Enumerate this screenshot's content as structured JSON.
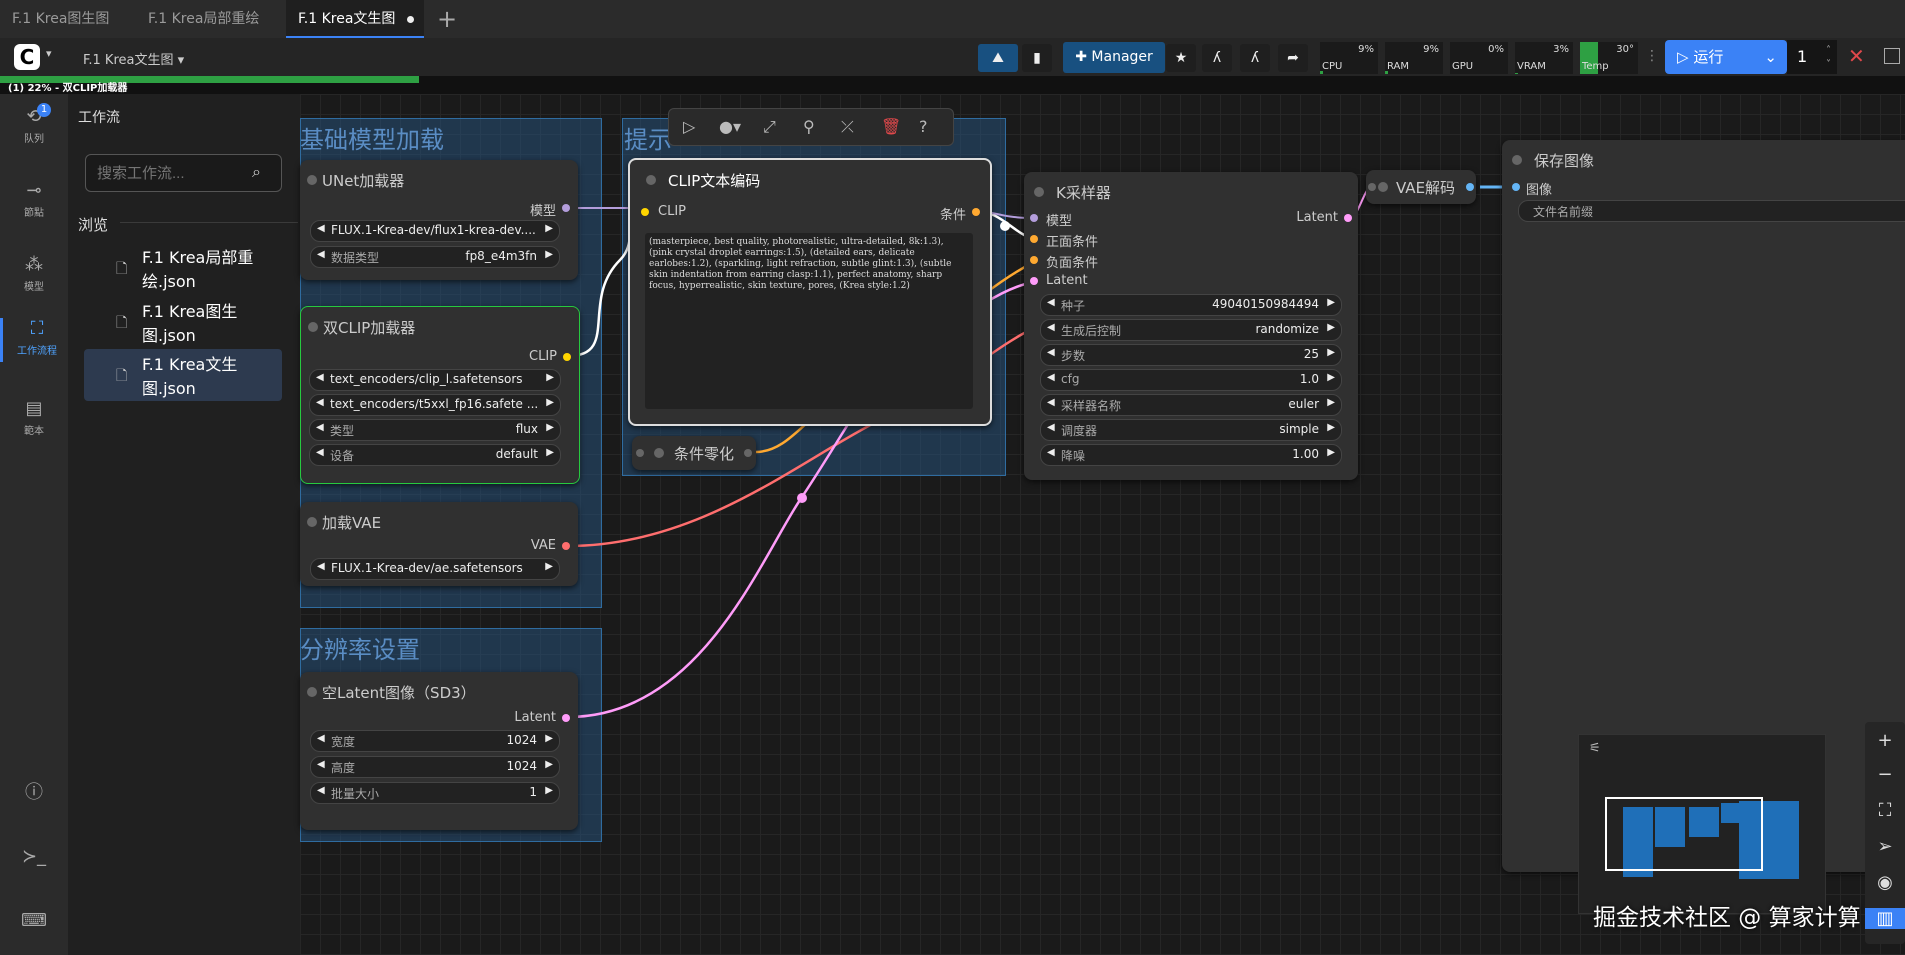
{
  "tabs": [
    {
      "label": "F.1 Krea图生图"
    },
    {
      "label": "F.1 Krea局部重绘"
    },
    {
      "label": "F.1 Krea文生图"
    }
  ],
  "menubar": {
    "workflow_name": "F.1 Krea文生图",
    "manager_label": "Manager",
    "resources": [
      {
        "label": "CPU",
        "value": "9%"
      },
      {
        "label": "RAM",
        "value": "9%"
      },
      {
        "label": "GPU",
        "value": "0%"
      },
      {
        "label": "VRAM",
        "value": "3%"
      },
      {
        "label": "Temp",
        "value": "30°"
      }
    ],
    "run_label": "运行",
    "run_count": "1"
  },
  "progress": {
    "text": "(1) 22% - 双CLIP加载器",
    "fraction": 0.22
  },
  "rail": [
    {
      "label": "队列",
      "icon": "history-icon",
      "badge": "1"
    },
    {
      "label": "節點",
      "icon": "node-icon"
    },
    {
      "label": "模型",
      "icon": "model-icon"
    },
    {
      "label": "工作流程",
      "icon": "workflow-icon"
    },
    {
      "label": "範本",
      "icon": "template-icon"
    }
  ],
  "sidebar": {
    "title": "工作流",
    "search_placeholder": "搜索工作流...",
    "browse_label": "浏览",
    "files": [
      {
        "name": "F.1 Krea局部重绘.json"
      },
      {
        "name": "F.1 Krea图生图.json"
      },
      {
        "name": "F.1 Krea文生图.json"
      }
    ]
  },
  "groups": {
    "model_load": "基础模型加载",
    "prompt": "提示",
    "resolution": "分辨率设置"
  },
  "nodes": {
    "unet": {
      "title": "UNet加载器",
      "output": "模型",
      "widgets": [
        {
          "value": "FLUX.1-Krea-dev/flux1-krea-dev...."
        },
        {
          "label": "数据类型",
          "value": "fp8_e4m3fn"
        }
      ]
    },
    "dualclip": {
      "title": "双CLIP加载器",
      "output": "CLIP",
      "widgets": [
        {
          "value": "text_encoders/clip_l.safetensors"
        },
        {
          "value": "text_encoders/t5xxl_fp16.safete ..."
        },
        {
          "label": "类型",
          "value": "flux"
        },
        {
          "label": "设备",
          "value": "default"
        }
      ]
    },
    "vae": {
      "title": "加载VAE",
      "output": "VAE",
      "widgets": [
        {
          "value": "FLUX.1-Krea-dev/ae.safetensors"
        }
      ]
    },
    "latent": {
      "title": "空Latent图像（SD3）",
      "output": "Latent",
      "widgets": [
        {
          "label": "宽度",
          "value": "1024"
        },
        {
          "label": "高度",
          "value": "1024"
        },
        {
          "label": "批量大小",
          "value": "1"
        }
      ]
    },
    "clip_encode": {
      "title": "CLIP文本编码",
      "input": "CLIP",
      "output": "条件",
      "prompt": "(masterpiece, best quality, photorealistic, ultra-detailed, 8k:1.3), (pink crystal droplet earrings:1.5), (detailed ears, delicate earlobes:1.2), (sparkling, light refraction, subtle glint:1.3), (subtle skin indentation from earring clasp:1.1), perfect anatomy, sharp focus, hyperrealistic, skin texture, pores, (Krea style:1.2)"
    },
    "zero": {
      "title": "条件零化"
    },
    "ksampler": {
      "title": "K采样器",
      "inputs": [
        "模型",
        "正面条件",
        "负面条件",
        "Latent"
      ],
      "output": "Latent",
      "widgets": [
        {
          "label": "种子",
          "value": "49040150984494"
        },
        {
          "label": "生成后控制",
          "value": "randomize"
        },
        {
          "label": "步数",
          "value": "25"
        },
        {
          "label": "cfg",
          "value": "1.0"
        },
        {
          "label": "采样器名称",
          "value": "euler"
        },
        {
          "label": "调度器",
          "value": "simple"
        },
        {
          "label": "降噪",
          "value": "1.00"
        }
      ]
    },
    "vae_decode": {
      "title": "VAE解码"
    },
    "save": {
      "title": "保存图像",
      "input": "图像",
      "widget_label": "文件名前缀"
    }
  },
  "watermark": "掘金技术社区 @ 算家计算",
  "colors": {
    "accent": "#3b82f6",
    "model_wire": "#b39ddb",
    "clip_wire": "#ffd500",
    "vae_wire": "#ff6e6e",
    "latent_wire": "#ff9cf9",
    "cond_wire": "#ffa931",
    "image_wire": "#64b5f6"
  }
}
